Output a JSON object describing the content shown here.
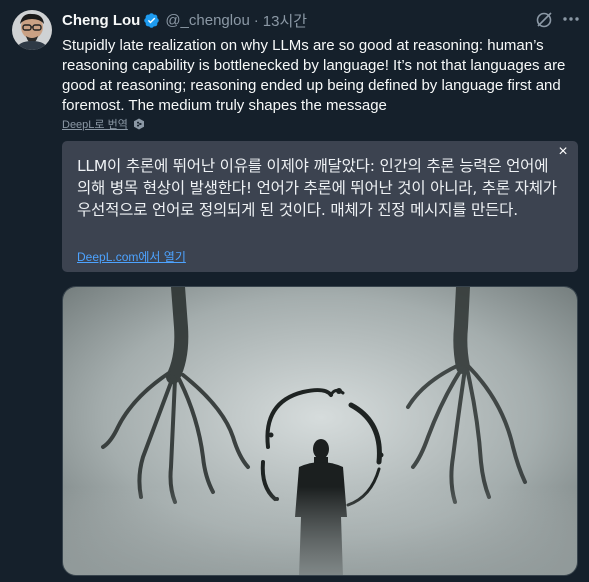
{
  "author": {
    "name": "Cheng Lou",
    "handle": "@_chenglou",
    "separator": "·",
    "time": "13시간"
  },
  "icons": {
    "verified": "verified-badge-icon",
    "grok": "grok-icon",
    "more": "more-options-icon",
    "deepl": "deepl-logo-icon",
    "close": "close-icon"
  },
  "tweet": {
    "text": "Stupidly late realization on why LLMs are so good at reasoning: human’s reasoning capability is bottlenecked by language! It’s not that languages are good at reasoning; reasoning ended up being defined by language first and foremost. The medium truly shapes the message"
  },
  "translate": {
    "link_label": "DeepL로 번역"
  },
  "translation": {
    "text": "LLM이 추론에 뛰어난 이유를 이제야 깨달았다: 인간의 추론 능력은 언어에 의해 병목 현상이 발생한다! 언어가 추론에 뛰어난 것이 아니라, 추론 자체가 우선적으로 언어로 정의되게 된 것이다. 매체가 진정 메시지를 만든다.",
    "close_label": "×",
    "open_link": "DeepL.com에서 열기"
  },
  "colors": {
    "background": "#15202b",
    "text": "#f7f9f9",
    "secondary": "#8b98a5",
    "verified": "#1d9bf0",
    "translation_bg": "#3c4350",
    "link": "#4da3ff"
  },
  "media": {
    "kind": "image",
    "subject": "foggy-scene-with-figure-and-giant-hands"
  }
}
